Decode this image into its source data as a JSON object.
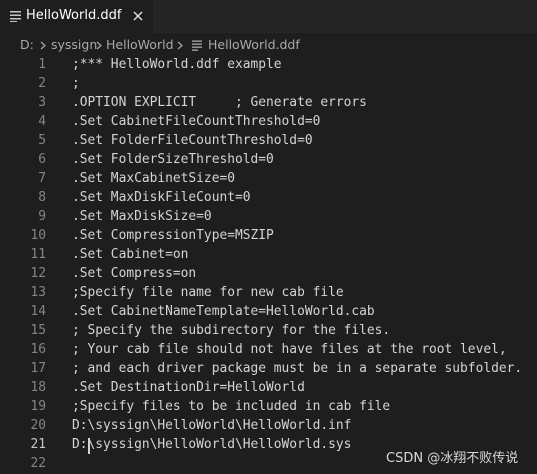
{
  "tab": {
    "label": "HelloWorld.ddf",
    "icon": "lines-file-icon",
    "close_icon": "close-icon"
  },
  "breadcrumb": {
    "drive": "D:",
    "folder1": "syssign",
    "folder2": "HelloWorld",
    "file": "HelloWorld.ddf"
  },
  "editor": {
    "active_line": 21,
    "lines": [
      {
        "num": "1",
        "text": ";*** HelloWorld.ddf example"
      },
      {
        "num": "2",
        "text": ";"
      },
      {
        "num": "3",
        "text": ".OPTION EXPLICIT     ; Generate errors"
      },
      {
        "num": "4",
        "text": ".Set CabinetFileCountThreshold=0"
      },
      {
        "num": "5",
        "text": ".Set FolderFileCountThreshold=0"
      },
      {
        "num": "6",
        "text": ".Set FolderSizeThreshold=0"
      },
      {
        "num": "7",
        "text": ".Set MaxCabinetSize=0"
      },
      {
        "num": "8",
        "text": ".Set MaxDiskFileCount=0"
      },
      {
        "num": "9",
        "text": ".Set MaxDiskSize=0"
      },
      {
        "num": "10",
        "text": ".Set CompressionType=MSZIP"
      },
      {
        "num": "11",
        "text": ".Set Cabinet=on"
      },
      {
        "num": "12",
        "text": ".Set Compress=on"
      },
      {
        "num": "13",
        "text": ";Specify file name for new cab file"
      },
      {
        "num": "14",
        "text": ".Set CabinetNameTemplate=HelloWorld.cab"
      },
      {
        "num": "15",
        "text": "; Specify the subdirectory for the files."
      },
      {
        "num": "16",
        "text": "; Your cab file should not have files at the root level,"
      },
      {
        "num": "17",
        "text": "; and each driver package must be in a separate subfolder."
      },
      {
        "num": "18",
        "text": ".Set DestinationDir=HelloWorld"
      },
      {
        "num": "19",
        "text": ";Specify files to be included in cab file"
      },
      {
        "num": "20",
        "text": "D:\\syssign\\HelloWorld\\HelloWorld.inf"
      },
      {
        "num": "21",
        "text": "D:\\syssign\\HelloWorld\\HelloWorld.sys"
      },
      {
        "num": "22",
        "text": ""
      }
    ]
  },
  "watermark": "CSDN @冰翔不败传说"
}
